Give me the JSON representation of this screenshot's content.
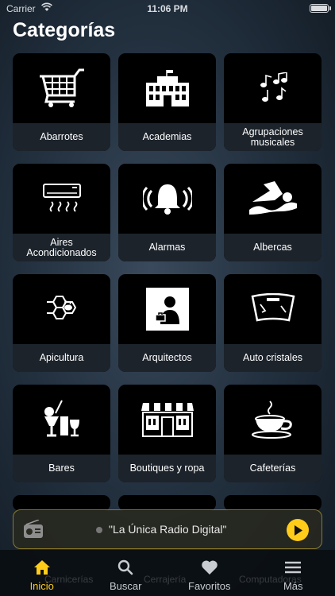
{
  "status_bar": {
    "carrier": "Carrier",
    "time": "11:06 PM"
  },
  "title": "Categorías",
  "categories": [
    {
      "label": "Abarrotes",
      "icon": "shopping-cart-icon"
    },
    {
      "label": "Academias",
      "icon": "school-building-icon"
    },
    {
      "label": "Agrupaciones musicales",
      "icon": "music-notes-icon"
    },
    {
      "label": "Aires Acondicionados",
      "icon": "air-conditioner-icon"
    },
    {
      "label": "Alarmas",
      "icon": "alarm-bell-icon"
    },
    {
      "label": "Albercas",
      "icon": "swimmer-icon"
    },
    {
      "label": "Apicultura",
      "icon": "honeycomb-bee-icon"
    },
    {
      "label": "Arquitectos",
      "icon": "architect-icon"
    },
    {
      "label": "Auto cristales",
      "icon": "windshield-icon"
    },
    {
      "label": "Bares",
      "icon": "cocktail-icon"
    },
    {
      "label": "Boutiques y ropa",
      "icon": "storefront-icon"
    },
    {
      "label": "Cafeterías",
      "icon": "coffee-cup-icon"
    }
  ],
  "player": {
    "station": "\"La Única Radio Digital\"",
    "accent": "#ffcc1a"
  },
  "tabs": [
    {
      "label": "Inicio",
      "icon": "home-icon",
      "active": true
    },
    {
      "label": "Buscar",
      "icon": "search-icon",
      "active": false
    },
    {
      "label": "Favoritos",
      "icon": "heart-icon",
      "active": false
    },
    {
      "label": "Más",
      "icon": "menu-icon",
      "active": false
    }
  ],
  "ghost_labels": [
    "Carnicerías",
    "Cerrajería",
    "Computadoras"
  ]
}
